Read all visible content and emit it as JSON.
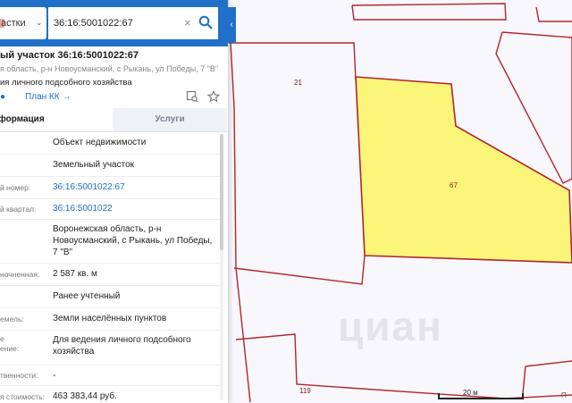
{
  "search": {
    "category_label": "астки",
    "query_value": "36:16:5001022:67",
    "clear_glyph": "×",
    "collapse_glyph": "‹"
  },
  "parcel": {
    "title": "ый участок 36:16:5001022:67",
    "address_short": "я область, р-н Новоусманский, с Рыкань, ул Победы, 7 \"В\"",
    "purpose_short": "ия личного подсобного хозяйства",
    "plan_link": "План КК →",
    "link_marker": "●"
  },
  "tabs": {
    "info": "формация",
    "services": "Услуги"
  },
  "properties": [
    {
      "key": "",
      "value": "Объект недвижимости",
      "link": false
    },
    {
      "key": "",
      "value": "Земельный участок",
      "link": false
    },
    {
      "key": "й номер:",
      "value": "36:16:5001022:67",
      "link": true
    },
    {
      "key": "й квартал:",
      "value": "36:16:5001022",
      "link": true
    },
    {
      "key": "",
      "value": "Воронежская область, р-н Новоусманский, с Рыкань, ул Победы, 7 \"В\"",
      "link": false
    },
    {
      "key": "ночненная:",
      "value": "2 587 кв. м",
      "link": false
    },
    {
      "key": "",
      "value": "Ранее учтенный",
      "link": false
    },
    {
      "key": "емель:",
      "value": "Земли населённых пунктов",
      "link": false
    },
    {
      "key": "е\nение:",
      "value": "Для ведения личного подсобного хозяйства",
      "link": false
    },
    {
      "key": "твенности:",
      "value": "-",
      "link": false
    },
    {
      "key": "я стоимость:",
      "value": "463 383,44 руб.",
      "link": false
    }
  ],
  "map": {
    "labels": [
      "21",
      "67",
      "119"
    ],
    "scale": "20 м",
    "edge_label": "П",
    "watermark": "циан",
    "colors": {
      "parcel_fill": "#fbf57a",
      "boundary": "#b3262c",
      "accent": "#2170c7"
    }
  },
  "icons": {
    "search": "search-icon",
    "print": "print-map-icon",
    "favorite": "star-icon"
  }
}
